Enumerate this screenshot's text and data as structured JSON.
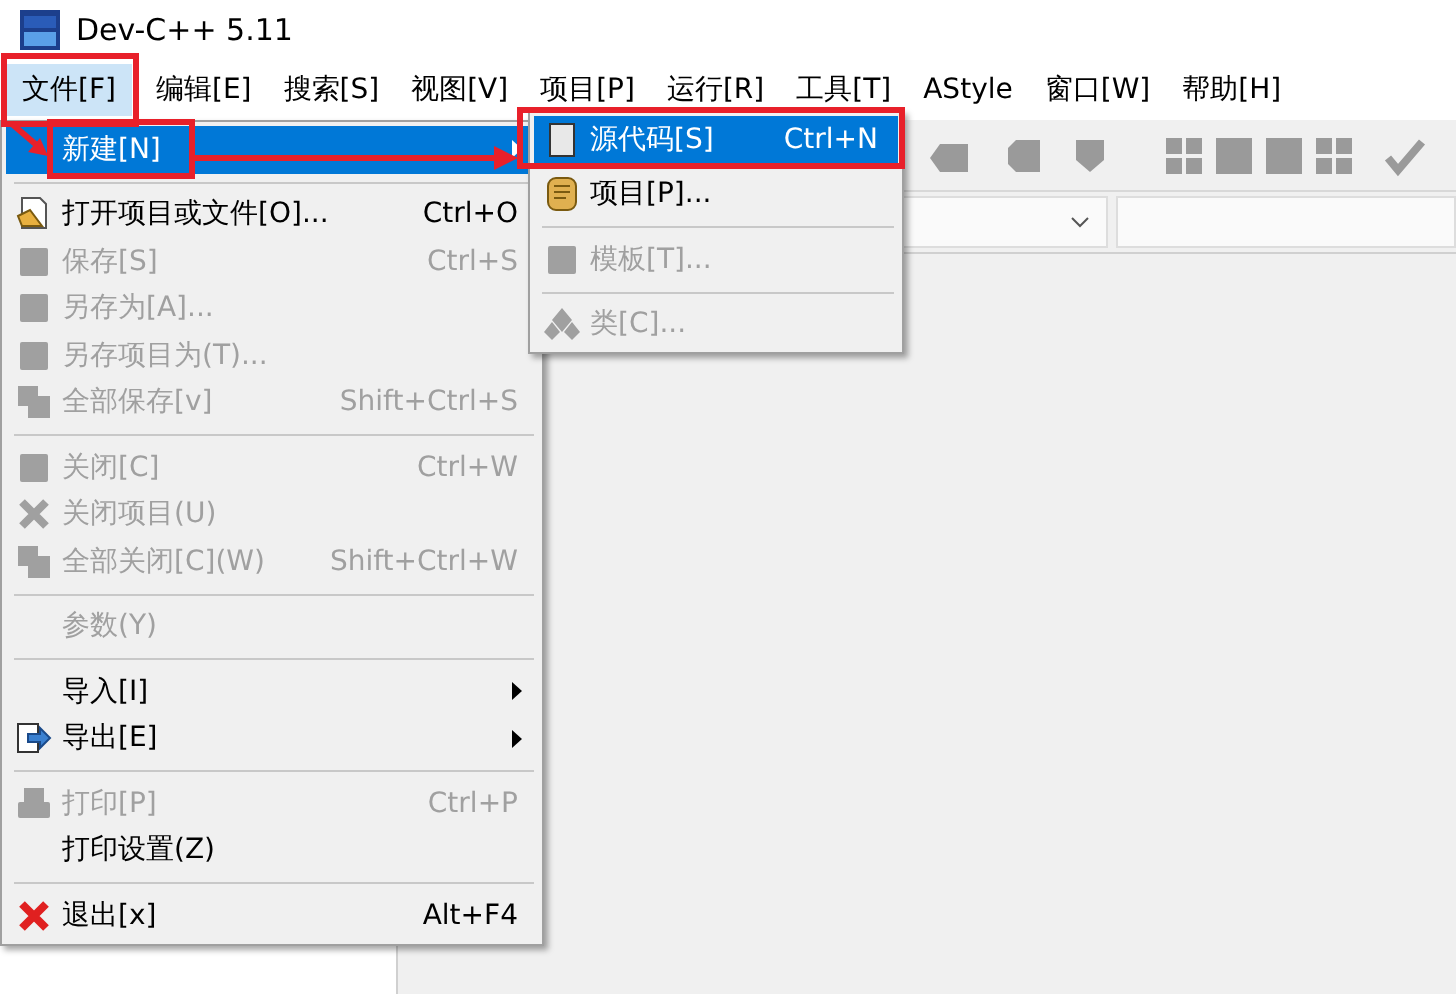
{
  "window": {
    "title": "Dev-C++ 5.11"
  },
  "menu_bar": [
    {
      "label": "文件[F]",
      "selected": true
    },
    {
      "label": "编辑[E]",
      "selected": false
    },
    {
      "label": "搜索[S]",
      "selected": false
    },
    {
      "label": "视图[V]",
      "selected": false
    },
    {
      "label": "项目[P]",
      "selected": false
    },
    {
      "label": "运行[R]",
      "selected": false
    },
    {
      "label": "工具[T]",
      "selected": false
    },
    {
      "label": "AStyle",
      "selected": false
    },
    {
      "label": "窗口[W]",
      "selected": false
    },
    {
      "label": "帮助[H]",
      "selected": false
    }
  ],
  "file_menu": [
    {
      "kind": "item",
      "label": "新建[N]",
      "selected": true,
      "disabled": false,
      "submenu": true
    },
    {
      "kind": "separator"
    },
    {
      "kind": "item",
      "label": "打开项目或文件[O]...",
      "shortcut": "Ctrl+O",
      "selected": false,
      "disabled": false,
      "submenu": false
    },
    {
      "kind": "item",
      "label": "保存[S]",
      "shortcut": "Ctrl+S",
      "selected": false,
      "disabled": true,
      "submenu": false
    },
    {
      "kind": "item",
      "label": "另存为[A]...",
      "selected": false,
      "disabled": true,
      "submenu": false
    },
    {
      "kind": "item",
      "label": "另存项目为(T)...",
      "selected": false,
      "disabled": true,
      "submenu": false
    },
    {
      "kind": "item",
      "label": "全部保存[v]",
      "shortcut": "Shift+Ctrl+S",
      "selected": false,
      "disabled": true,
      "submenu": false
    },
    {
      "kind": "separator"
    },
    {
      "kind": "item",
      "label": "关闭[C]",
      "shortcut": "Ctrl+W",
      "selected": false,
      "disabled": true,
      "submenu": false
    },
    {
      "kind": "item",
      "label": "关闭项目(U)",
      "selected": false,
      "disabled": true,
      "submenu": false
    },
    {
      "kind": "item",
      "label": "全部关闭[C](W)",
      "shortcut": "Shift+Ctrl+W",
      "selected": false,
      "disabled": true,
      "submenu": false
    },
    {
      "kind": "separator"
    },
    {
      "kind": "item",
      "label": "参数(Y)",
      "selected": false,
      "disabled": true,
      "submenu": false
    },
    {
      "kind": "separator"
    },
    {
      "kind": "item",
      "label": "导入[I]",
      "selected": false,
      "disabled": false,
      "submenu": true
    },
    {
      "kind": "item",
      "label": "导出[E]",
      "selected": false,
      "disabled": false,
      "submenu": true
    },
    {
      "kind": "separator"
    },
    {
      "kind": "item",
      "label": "打印[P]",
      "shortcut": "Ctrl+P",
      "selected": false,
      "disabled": true,
      "submenu": false
    },
    {
      "kind": "item",
      "label": "打印设置(Z)",
      "selected": false,
      "disabled": false,
      "submenu": false
    },
    {
      "kind": "separator"
    },
    {
      "kind": "item",
      "label": "退出[x]",
      "shortcut": "Alt+F4",
      "selected": false,
      "disabled": false,
      "submenu": false
    }
  ],
  "new_submenu": [
    {
      "kind": "item",
      "label": "源代码[S]",
      "shortcut": "Ctrl+N",
      "selected": true,
      "disabled": false
    },
    {
      "kind": "item",
      "label": "项目[P]...",
      "selected": false,
      "disabled": false
    },
    {
      "kind": "separator"
    },
    {
      "kind": "item",
      "label": "模板[T]...",
      "selected": false,
      "disabled": true
    },
    {
      "kind": "separator"
    },
    {
      "kind": "item",
      "label": "类[C]...",
      "selected": false,
      "disabled": true
    }
  ]
}
